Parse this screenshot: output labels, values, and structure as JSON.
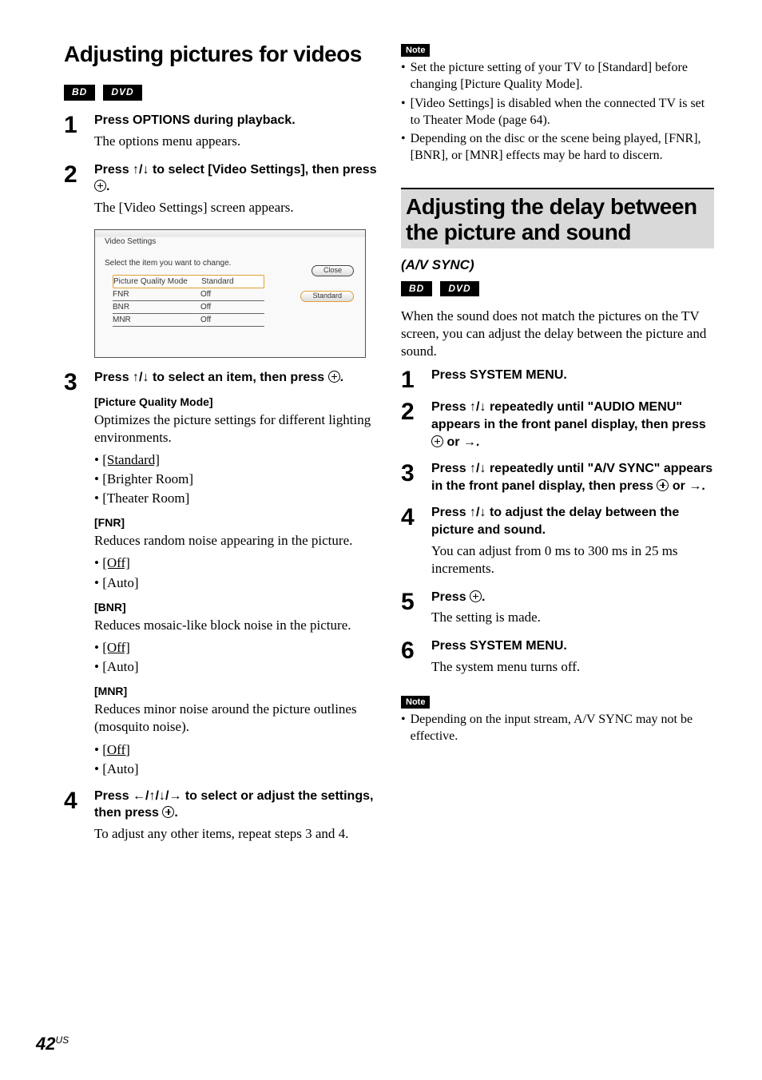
{
  "left": {
    "heading": "Adjusting pictures for videos",
    "badges": [
      "BD",
      "DVD"
    ],
    "steps": [
      {
        "num": "1",
        "title_pre": "Press OPTIONS during playback.",
        "desc": "The options menu appears."
      },
      {
        "num": "2",
        "title_pre": "Press ",
        "title_arrows": "↑/↓",
        "title_mid": " to select [Video Settings], then press ",
        "title_post": ".",
        "desc": "The [Video Settings] screen appears."
      },
      {
        "num": "3",
        "title_pre": "Press ",
        "title_arrows": "↑/↓",
        "title_post": " to select an item, then press ",
        "title_end": "."
      },
      {
        "num": "4",
        "title_pre": "Press ",
        "title_arrows": "←/↑/↓/→",
        "title_post": " to select or adjust the settings, then press ",
        "title_end": ".",
        "desc": "To adjust any other items, repeat steps 3 and 4."
      }
    ],
    "panel": {
      "title": "Video Settings",
      "instruction": "Select the item you want to change.",
      "rows": [
        {
          "name": "Picture Quality Mode",
          "value": "Standard",
          "selected": true
        },
        {
          "name": "FNR",
          "value": "Off"
        },
        {
          "name": "BNR",
          "value": "Off"
        },
        {
          "name": "MNR",
          "value": "Off"
        }
      ],
      "close": "Close",
      "standard": "Standard"
    },
    "sections": [
      {
        "head": "[Picture Quality Mode]",
        "desc": "Optimizes the picture settings for different lighting environments.",
        "items": [
          {
            "text": "[Standard]",
            "underline": true
          },
          {
            "text": "[Brighter Room]"
          },
          {
            "text": "[Theater Room]"
          }
        ]
      },
      {
        "head": "[FNR]",
        "desc": "Reduces random noise appearing in the picture.",
        "items": [
          {
            "text": "[Off]",
            "underline": true
          },
          {
            "text": "[Auto]"
          }
        ]
      },
      {
        "head": "[BNR]",
        "desc": "Reduces mosaic-like block noise in the picture.",
        "items": [
          {
            "text": "[Off]",
            "underline": true
          },
          {
            "text": "[Auto]"
          }
        ]
      },
      {
        "head": "[MNR]",
        "desc": "Reduces minor noise around the picture outlines (mosquito noise).",
        "items": [
          {
            "text": "[Off]",
            "underline": true
          },
          {
            "text": "[Auto]"
          }
        ]
      }
    ]
  },
  "right": {
    "note1_label": "Note",
    "note1_items": [
      "Set the picture setting of your TV to [Standard] before changing [Picture Quality Mode].",
      "[Video Settings] is disabled when the connected TV is set to Theater Mode (page 64).",
      "Depending on the disc or the scene being played, [FNR], [BNR], or [MNR] effects may be hard to discern."
    ],
    "heading": "Adjusting the delay between the picture and sound",
    "subtitle": "(A/V SYNC)",
    "badges": [
      "BD",
      "DVD"
    ],
    "intro": "When the sound does not match the pictures on the TV screen, you can adjust the delay between the picture and sound.",
    "steps": [
      {
        "num": "1",
        "title": "Press SYSTEM MENU."
      },
      {
        "num": "2",
        "title_pre": "Press ",
        "title_arrows": "↑/↓",
        "title_mid": " repeatedly until \"AUDIO MENU\" appears in the front panel display, then press ",
        "title_or": " or ",
        "title_arrow2": "→",
        "title_end": "."
      },
      {
        "num": "3",
        "title_pre": "Press ",
        "title_arrows": "↑/↓",
        "title_mid": " repeatedly until \"A/V SYNC\" appears in the front panel display, then press ",
        "title_or": " or ",
        "title_arrow2": "→",
        "title_end": "."
      },
      {
        "num": "4",
        "title_pre": "Press ",
        "title_arrows": "↑/↓",
        "title_post": " to adjust the delay between the picture and sound.",
        "desc": "You can adjust from 0 ms to 300 ms in 25 ms increments."
      },
      {
        "num": "5",
        "title_pre": "Press ",
        "title_end": ".",
        "desc": "The setting is made."
      },
      {
        "num": "6",
        "title": "Press SYSTEM MENU.",
        "desc": "The system menu turns off."
      }
    ],
    "note2_label": "Note",
    "note2_items": [
      "Depending on the input stream, A/V SYNC may not be effective."
    ]
  },
  "page": {
    "num": "42",
    "suffix": "US"
  }
}
